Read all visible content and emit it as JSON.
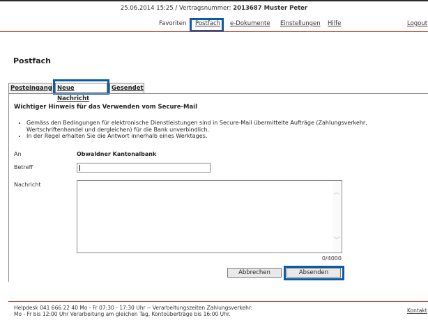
{
  "header": {
    "datetime_prefix": "25.06.2014 15:25 / Vertragsnummer: ",
    "contract_and_name": "2013687 Muster Peter"
  },
  "nav": {
    "favoriten": "Favoriten",
    "postfach": "Postfach",
    "edokumente": "e-Dokumente",
    "einstellungen": "Einstellungen",
    "hilfe": "Hilfe",
    "logout": "Logout"
  },
  "page": {
    "title": "Postfach"
  },
  "tabs": {
    "posteingang": "Posteingang",
    "neue_nachricht": "Neue Nachricht",
    "gesendet": "Gesendet"
  },
  "notice": {
    "title": "Wichtiger Hinweis für das Verwenden vom Secure-Mail",
    "bullet1": "Gemäss den Bedingungen für elektronische Dienstleistungen sind in Secure-Mail übermittelte Aufträge (Zahlungsverkehr, Wertschriftenhandel und dergleichen) für die Bank unverbindlich.",
    "bullet2": "In der Regel erhalten Sie die Antwort innerhalb eines Werktages."
  },
  "form": {
    "an_label": "An",
    "an_value": "Obwaldner Kantonalbank",
    "betreff_label": "Betreff",
    "betreff_value": "",
    "nachricht_label": "Nachricht",
    "nachricht_value": "",
    "counter": "0/4000",
    "cancel_label": "Abbrechen",
    "send_label": "Absenden"
  },
  "footer": {
    "line1": "Helpdesk 041 666 22 40 Mo - Fr 07:30 - 17:30 Uhr    --   Verarbeitungszeiten Zahlungsverkehr:",
    "line2": "Mo - Fr bis 12:00 Uhr Verarbeitung am gleichen Tag, Kontoüberträge bis 16:00 Uhr.",
    "kontakt": "Kontakt"
  },
  "colors": {
    "highlight": "#0a5aa6",
    "accent_line": "#c0392b"
  }
}
